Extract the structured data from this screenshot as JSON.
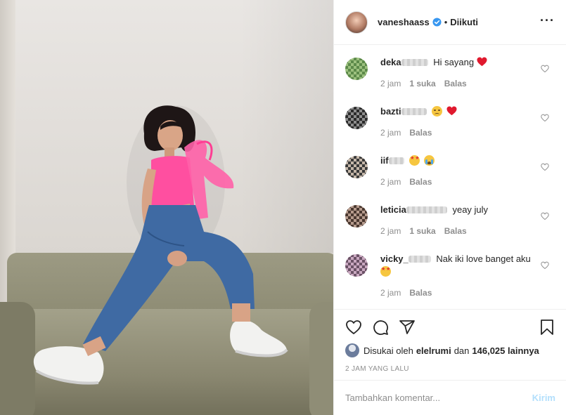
{
  "post": {
    "username": "vaneshaass",
    "follow_status": "Diikuti",
    "separator": "•"
  },
  "comments": [
    {
      "handle": "deka",
      "text": " Hi sayang",
      "emojis": [
        "red-heart"
      ],
      "time": "2 jam",
      "likes": "1 suka",
      "reply": "Balas"
    },
    {
      "handle": "bazti",
      "text": "",
      "emojis": [
        "disappointed-face",
        "red-heart"
      ],
      "time": "2 jam",
      "likes": "",
      "reply": "Balas"
    },
    {
      "handle": "iif",
      "text": "",
      "emojis": [
        "star-struck-face",
        "loudly-crying-face"
      ],
      "time": "2 jam",
      "likes": "",
      "reply": "Balas"
    },
    {
      "handle": "leticia",
      "text": " yeay july",
      "emojis": [],
      "time": "2 jam",
      "likes": "1 suka",
      "reply": "Balas"
    },
    {
      "handle": "vicky_",
      "text": " Nak iki love banget aku",
      "emojis": [
        "star-struck-face"
      ],
      "time": "2 jam",
      "likes": "",
      "reply": "Balas"
    }
  ],
  "likes": {
    "prefix": "Disukai oleh",
    "user": "elelrumi",
    "conjunction": "dan",
    "count": "146,025 lainnya"
  },
  "timestamp": "2 JAM YANG LALU",
  "comment_input": {
    "placeholder": "Tambahkan komentar...",
    "post_label": "Kirim"
  },
  "colors": {
    "verified": "#3897f0",
    "heart": "#ed4956",
    "post_disabled": "#b2dffc",
    "muted": "#8e8e8e",
    "top_color": "#ff4fa0",
    "jeans": "#3f6aa3"
  },
  "icons": [
    "heart-icon",
    "comment-icon",
    "share-icon",
    "bookmark-icon",
    "more-icon",
    "verified-icon"
  ]
}
